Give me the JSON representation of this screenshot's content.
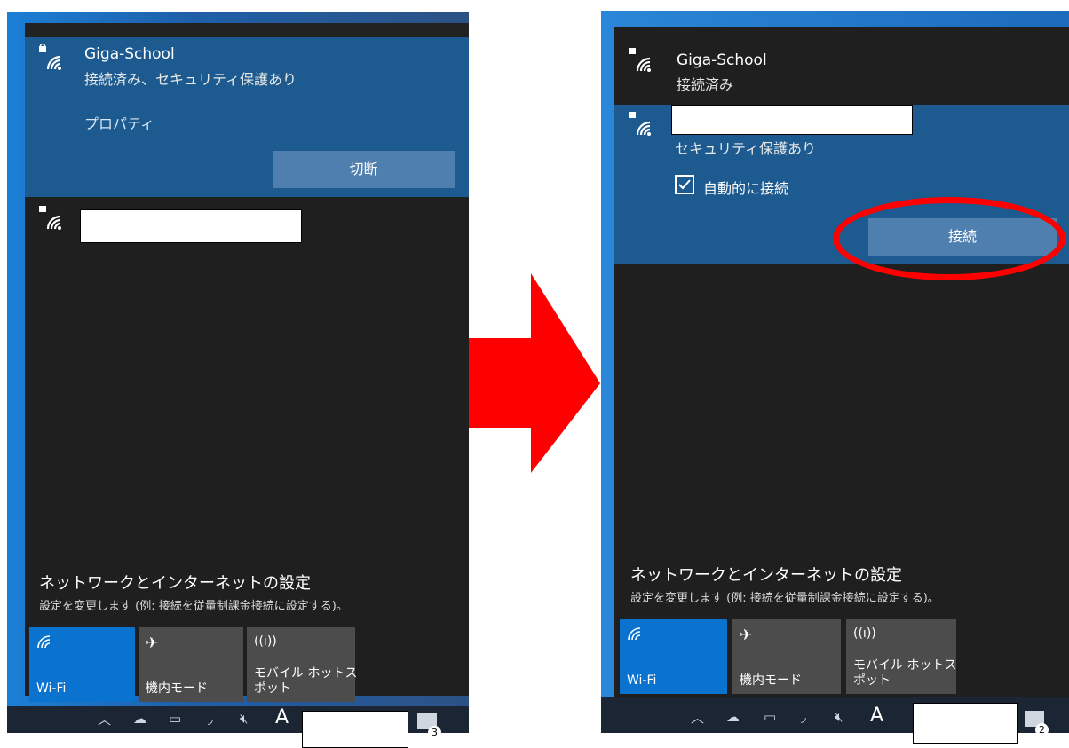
{
  "left": {
    "connected_network": {
      "ssid": "Giga-School",
      "status": "接続済み、セキュリティ保護あり",
      "properties_link": "プロパティ",
      "disconnect_button": "切断"
    },
    "settings": {
      "title": "ネットワークとインターネットの設定",
      "subtitle": "設定を変更します (例: 接続を従量制課金接続に設定する)。"
    },
    "quick_actions": [
      {
        "label": "Wi-Fi",
        "icon": "wifi-icon",
        "active": true
      },
      {
        "label": "機内モード",
        "icon": "airplane-icon",
        "active": false
      },
      {
        "label": "モバイル ホットス\nポット",
        "icon": "hotspot-icon",
        "active": false
      }
    ],
    "taskbar": {
      "ime": "A",
      "notifications_count": "3"
    }
  },
  "right": {
    "connected_network": {
      "ssid": "Giga-School",
      "status": "接続済み"
    },
    "selected_network": {
      "status": "セキュリティ保護あり",
      "auto_connect_label": "自動的に接続",
      "auto_connect_checked": true,
      "connect_button": "接続"
    },
    "settings": {
      "title": "ネットワークとインターネットの設定",
      "subtitle": "設定を変更します (例: 接続を従量制課金接続に設定する)。"
    },
    "quick_actions": [
      {
        "label": "Wi-Fi",
        "icon": "wifi-icon",
        "active": true
      },
      {
        "label": "機内モード",
        "icon": "airplane-icon",
        "active": false
      },
      {
        "label": "モバイル ホットス\nポット",
        "icon": "hotspot-icon",
        "active": false
      }
    ],
    "taskbar": {
      "ime": "A",
      "notifications_count": "2"
    }
  },
  "colors": {
    "accent": "#0a72cf",
    "selected_bg": "#1c5a8f",
    "panel_bg": "#1f1f1f",
    "annotation_red": "#ff0000"
  }
}
